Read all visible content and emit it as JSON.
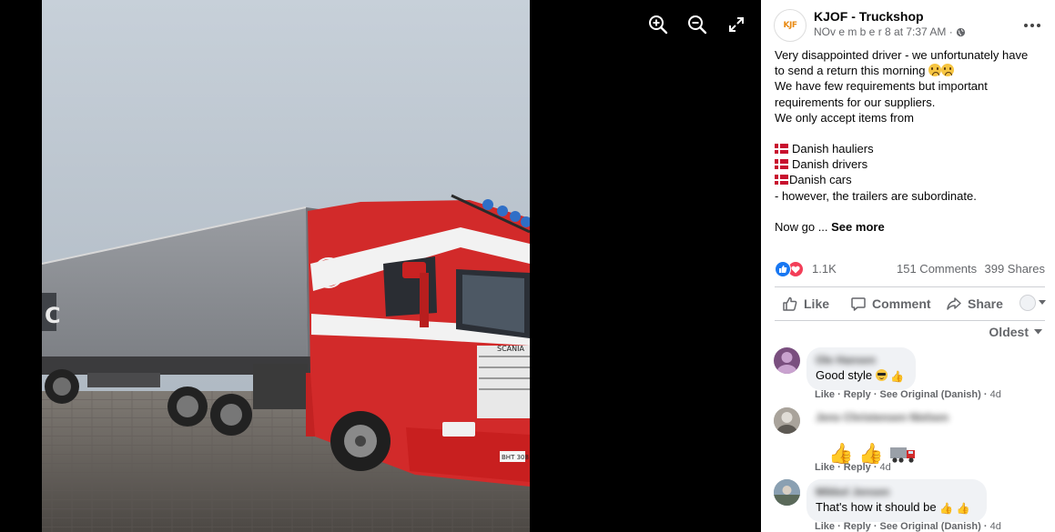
{
  "viewer": {
    "controls": [
      {
        "name": "zoom-in-icon"
      },
      {
        "name": "zoom-out-icon"
      },
      {
        "name": "fullscreen-icon"
      }
    ]
  },
  "post": {
    "page_name": "KJOF - Truckshop",
    "logo_text": "KJF",
    "timestamp": "NOv e m b e r 8 at 7:37 AM · ",
    "privacy_icon": "globe-icon",
    "text_lines": [
      "Very disappointed driver - we unfortunately have",
      "to send a return this morning ",
      "We have few requirements but important",
      "requirements for our suppliers.",
      "We only accept items from"
    ],
    "flag_items": [
      "Danish hauliers",
      "Danish drivers",
      "Danish cars"
    ],
    "after_flags": "- however, the trailers are subordinate.",
    "truncated": "Now go ... ",
    "see_more": "See more",
    "reaction_count": "1.1K",
    "comments_count": "151 Comments",
    "shares_count": "399 Shares",
    "actions": {
      "like": "Like",
      "comment": "Comment",
      "share": "Share"
    },
    "sort_label": "Oldest"
  },
  "comments": [
    {
      "name": "Ole Hansen",
      "text": "Good style ",
      "like": "Like",
      "reply": "Reply",
      "see_original": "See Original (Danish)",
      "age": "4d"
    },
    {
      "name": "Jens Christensen Nielsen",
      "text": "",
      "like": "Like",
      "reply": "Reply",
      "age": "4d"
    },
    {
      "name": "Mikkel Jensen",
      "text": "That's how it should be ",
      "like": "Like",
      "reply": "Reply",
      "see_original": "See Original (Danish)",
      "age": "4d"
    }
  ],
  "colors": {
    "truck_red": "#d22a2a",
    "trailer_gray": "#8e9196",
    "sky": "#b9c3cc",
    "like_blue": "#1877f2",
    "love_red": "#f33e58"
  }
}
